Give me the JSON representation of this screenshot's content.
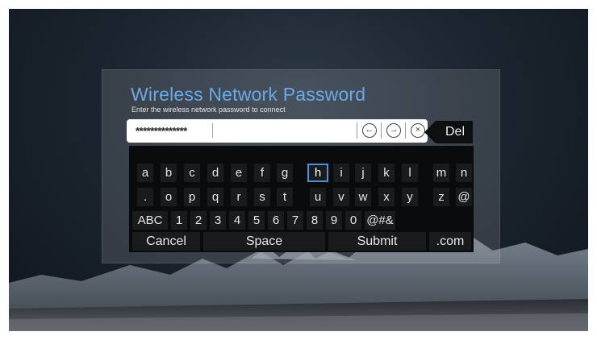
{
  "dialog": {
    "title": "Wireless Network Password",
    "subtitle": "Enter the wireless network password to connect"
  },
  "password_field": {
    "value": "**************",
    "controls": [
      "arrow-left-icon",
      "arrow-right-icon",
      "clear-icon"
    ]
  },
  "del_label": "Del",
  "keyboard": {
    "rows": [
      [
        "a",
        "b",
        "c",
        "d",
        "e",
        "f",
        "g",
        "h",
        "i",
        "j",
        "k",
        "l",
        "m",
        "n"
      ],
      [
        ".",
        "o",
        "p",
        "q",
        "r",
        "s",
        "t",
        "u",
        "v",
        "w",
        "x",
        "y",
        "z",
        "@"
      ],
      [
        "ABC",
        "1",
        "2",
        "3",
        "4",
        "5",
        "6",
        "7",
        "8",
        "9",
        "0",
        "@#&"
      ],
      [
        "Cancel",
        "Space",
        "Submit",
        ".com"
      ]
    ],
    "selected_key": "h"
  },
  "colors": {
    "accent": "#6aa9e8",
    "selection": "#4f8fd6"
  }
}
